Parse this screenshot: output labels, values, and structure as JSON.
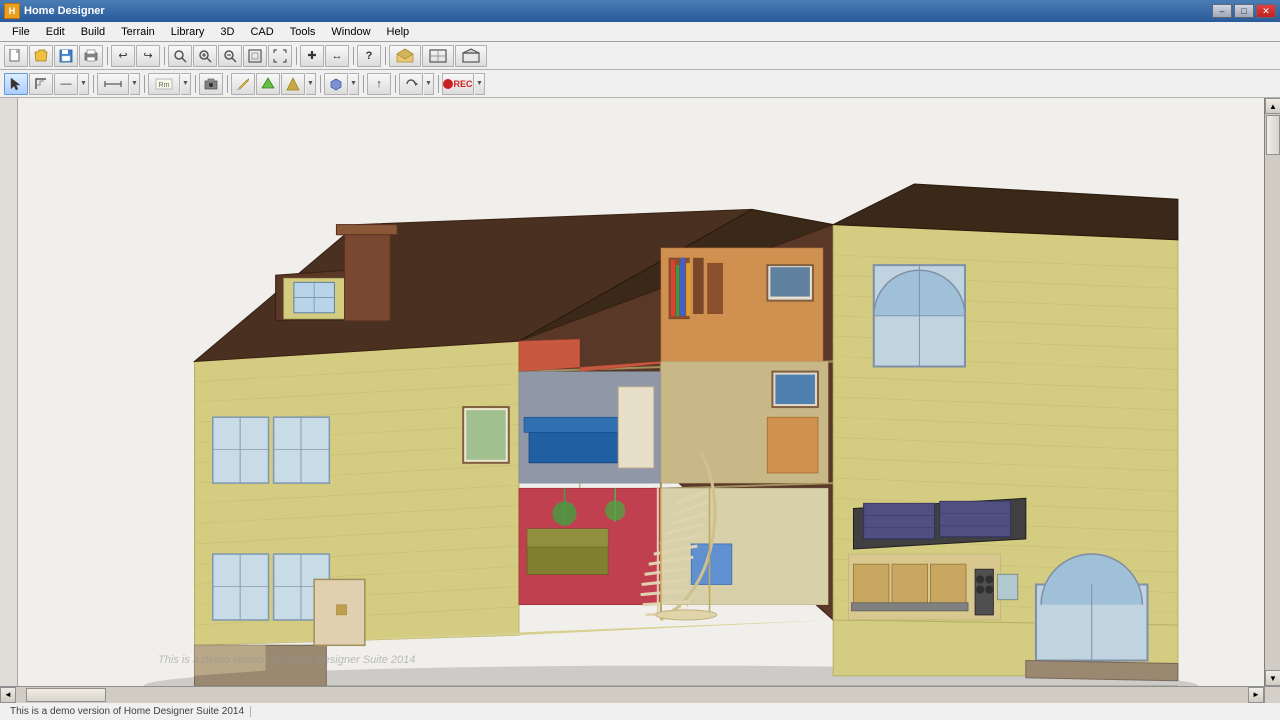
{
  "titleBar": {
    "appName": "Home Designer",
    "minLabel": "–",
    "restoreLabel": "❐",
    "closeLabel": "✕",
    "winControlsMin": "–",
    "winControlsMax": "□",
    "winControlsClose": "✕"
  },
  "menuBar": {
    "items": [
      "File",
      "Edit",
      "Build",
      "Terrain",
      "Library",
      "3D",
      "CAD",
      "Tools",
      "Window",
      "Help"
    ]
  },
  "toolbar1": {
    "buttons": [
      {
        "icon": "◻",
        "label": "new"
      },
      {
        "icon": "📄",
        "label": "open"
      },
      {
        "icon": "💾",
        "label": "save"
      },
      {
        "icon": "🖨",
        "label": "print"
      },
      {
        "icon": "↩",
        "label": "undo"
      },
      {
        "icon": "↪",
        "label": "redo"
      },
      {
        "icon": "🔍",
        "label": "search"
      },
      {
        "icon": "🔍+",
        "label": "zoom-in"
      },
      {
        "icon": "🔍-",
        "label": "zoom-out"
      },
      {
        "icon": "⬜",
        "label": "zoom-fit"
      },
      {
        "icon": "⬛",
        "label": "zoom-full"
      },
      {
        "icon": "🏠",
        "label": "house"
      },
      {
        "icon": "+",
        "label": "add"
      },
      {
        "icon": "↔",
        "label": "measure"
      },
      {
        "icon": "?",
        "label": "help"
      },
      {
        "icon": "🏠",
        "label": "3d-view"
      },
      {
        "icon": "🏠",
        "label": "floor-view"
      },
      {
        "icon": "🏠",
        "label": "elev-view"
      }
    ]
  },
  "toolbar2": {
    "buttons": [
      {
        "icon": "↖",
        "label": "select"
      },
      {
        "icon": "⌐",
        "label": "draw"
      },
      {
        "icon": "—",
        "label": "wall"
      },
      {
        "icon": "▦",
        "label": "floor"
      },
      {
        "icon": "🖼",
        "label": "camera"
      },
      {
        "icon": "◯",
        "label": "circle"
      },
      {
        "icon": "▲",
        "label": "terrain"
      },
      {
        "icon": "⬡",
        "label": "object"
      },
      {
        "icon": "↑",
        "label": "move"
      },
      {
        "icon": "⤺",
        "label": "rotate"
      },
      {
        "icon": "⏺",
        "label": "record"
      }
    ]
  },
  "statusBar": {
    "left": "This is a demo version of Home Designer Suite 2014",
    "scrollPos": ""
  },
  "canvas": {
    "bgColor": "#f5f5f5"
  }
}
